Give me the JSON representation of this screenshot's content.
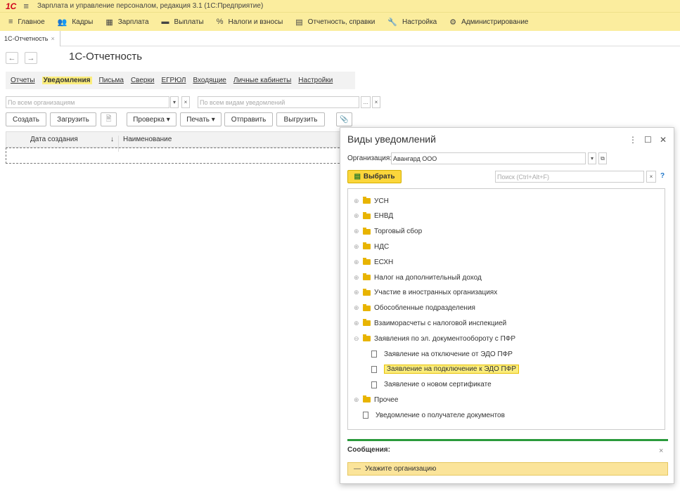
{
  "app": {
    "logo": "1С",
    "title": "Зарплата и управление персоналом, редакция 3.1  (1С:Предприятие)"
  },
  "menu": [
    {
      "icon": "≡",
      "icon_name": "menu-icon",
      "label": "Главное"
    },
    {
      "icon": "👥",
      "icon_name": "people-icon",
      "label": "Кадры"
    },
    {
      "icon": "▦",
      "icon_name": "calculator-icon",
      "label": "Зарплата"
    },
    {
      "icon": "▬",
      "icon_name": "payments-icon",
      "label": "Выплаты"
    },
    {
      "icon": "%",
      "icon_name": "percent-icon",
      "label": "Налоги и взносы"
    },
    {
      "icon": "▤",
      "icon_name": "report-icon",
      "label": "Отчетность, справки"
    },
    {
      "icon": "🔧",
      "icon_name": "wrench-icon",
      "label": "Настройка"
    },
    {
      "icon": "⚙",
      "icon_name": "gear-icon",
      "label": "Администрирование"
    }
  ],
  "tab": {
    "label": "1С-Отчетность",
    "close": "×"
  },
  "nav": {
    "back": "←",
    "forward": "→"
  },
  "page": {
    "title": "1С-Отчетность"
  },
  "subnav": [
    {
      "label": "Отчеты",
      "active": false
    },
    {
      "label": "Уведомления",
      "active": true
    },
    {
      "label": "Письма",
      "active": false
    },
    {
      "label": "Сверки",
      "active": false
    },
    {
      "label": "ЕГРЮЛ",
      "active": false
    },
    {
      "label": "Входящие",
      "active": false
    },
    {
      "label": "Личные кабинеты",
      "active": false
    },
    {
      "label": "Настройки",
      "active": false
    }
  ],
  "filters": {
    "org_placeholder": "По всем организациям",
    "kind_placeholder": "По всем видам уведомлений",
    "dropdown": "▾",
    "clear": "×",
    "ellipsis": "..."
  },
  "toolbar": {
    "create": "Создать",
    "load": "Загрузить",
    "check": "Проверка ▾",
    "print": "Печать ▾",
    "send": "Отправить",
    "export": "Выгрузить",
    "attach_icon": "📎",
    "doc_icon": "🗎"
  },
  "grid": {
    "col_date": "Дата создания",
    "sort_icon": "↓",
    "col_name": "Наименование"
  },
  "dialog": {
    "title": "Виды уведомлений",
    "menu_icon": "⋮",
    "maximize_icon": "☐",
    "close_icon": "✕",
    "org_label": "Организация:",
    "org_value": "Авангард ООО",
    "org_dropdown": "▾",
    "org_open": "⧉",
    "select_button": "Выбрать",
    "search_placeholder": "Поиск (Ctrl+Alt+F)",
    "search_clear": "×",
    "help": "?",
    "tree": [
      {
        "label": "УСН",
        "type": "folder",
        "level": 0,
        "expander": "⊕"
      },
      {
        "label": "ЕНВД",
        "type": "folder",
        "level": 0,
        "expander": "⊕"
      },
      {
        "label": "Торговый сбор",
        "type": "folder",
        "level": 0,
        "expander": "⊕"
      },
      {
        "label": "НДС",
        "type": "folder",
        "level": 0,
        "expander": "⊕"
      },
      {
        "label": "ЕСХН",
        "type": "folder",
        "level": 0,
        "expander": "⊕"
      },
      {
        "label": "Налог на дополнительный доход",
        "type": "folder",
        "level": 0,
        "expander": "⊕"
      },
      {
        "label": "Участие в иностранных организациях",
        "type": "folder",
        "level": 0,
        "expander": "⊕"
      },
      {
        "label": "Обособленные подразделения",
        "type": "folder",
        "level": 0,
        "expander": "⊕"
      },
      {
        "label": "Взаиморасчеты с налоговой инспекцией",
        "type": "folder",
        "level": 0,
        "expander": "⊕"
      },
      {
        "label": "Заявления по эл. документообороту с ПФР",
        "type": "folder",
        "level": 0,
        "expander": "⊖"
      },
      {
        "label": "Заявление на отключение от ЭДО ПФР",
        "type": "doc",
        "level": 1,
        "expander": ""
      },
      {
        "label": "Заявление на подключение к ЭДО ПФР",
        "type": "doc",
        "level": 1,
        "expander": "",
        "selected": true
      },
      {
        "label": "Заявление о новом сертификате",
        "type": "doc",
        "level": 1,
        "expander": ""
      },
      {
        "label": "Прочее",
        "type": "folder",
        "level": 0,
        "expander": "⊕"
      },
      {
        "label": "Уведомление о получателе документов",
        "type": "doc",
        "level": 0,
        "expander": ""
      }
    ],
    "messages_title": "Сообщения:",
    "messages_close": "×",
    "message": "Укажите организацию",
    "message_icon": "—"
  }
}
